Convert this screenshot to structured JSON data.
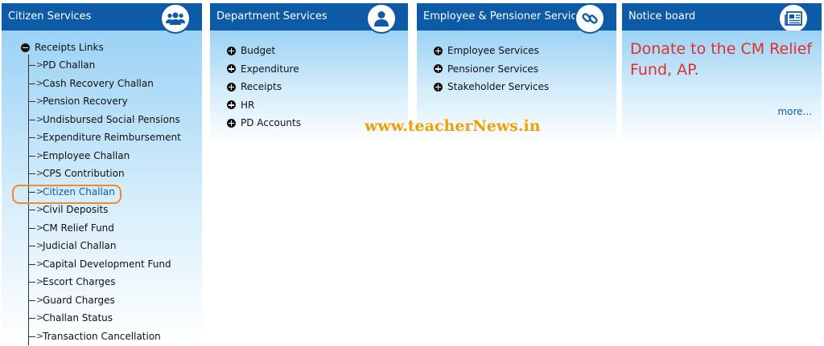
{
  "citizen": {
    "title": "Citizen Services",
    "root_label": "Receipts Links",
    "items": [
      "PD Challan",
      "Cash Recovery Challan",
      "Pension Recovery",
      "Undisbursed Social Pensions",
      "Expenditure Reimbursement",
      "Employee Challan",
      "CPS Contribution",
      "Citizen Challan",
      "Civil Deposits",
      "CM Relief Fund",
      "Judicial Challan",
      "Capital Development Fund",
      "Escort Charges",
      "Guard Charges",
      "Challan Status",
      "Transaction Cancellation"
    ],
    "active_item": "Citizen Challan"
  },
  "department": {
    "title": "Department Services",
    "items": [
      "Budget",
      "Expenditure",
      "Receipts",
      "HR",
      "PD Accounts"
    ]
  },
  "employee": {
    "title": "Employee & Pensioner Services",
    "items": [
      "Employee Services",
      "Pensioner Services",
      "Stakeholder Services"
    ]
  },
  "notice": {
    "title": "Notice board",
    "text": "Donate to the CM Relief Fund, AP.",
    "more": "more..."
  },
  "watermark": "www.teacherNews.in",
  "icons": {
    "citizen": "users-icon",
    "department": "user-icon",
    "employee": "link-icon",
    "notice": "newspaper-icon"
  },
  "colors": {
    "header": "#0d5aa7",
    "notice_text": "#e0302a",
    "highlight": "#f08a2c",
    "watermark": "#f0a000"
  }
}
